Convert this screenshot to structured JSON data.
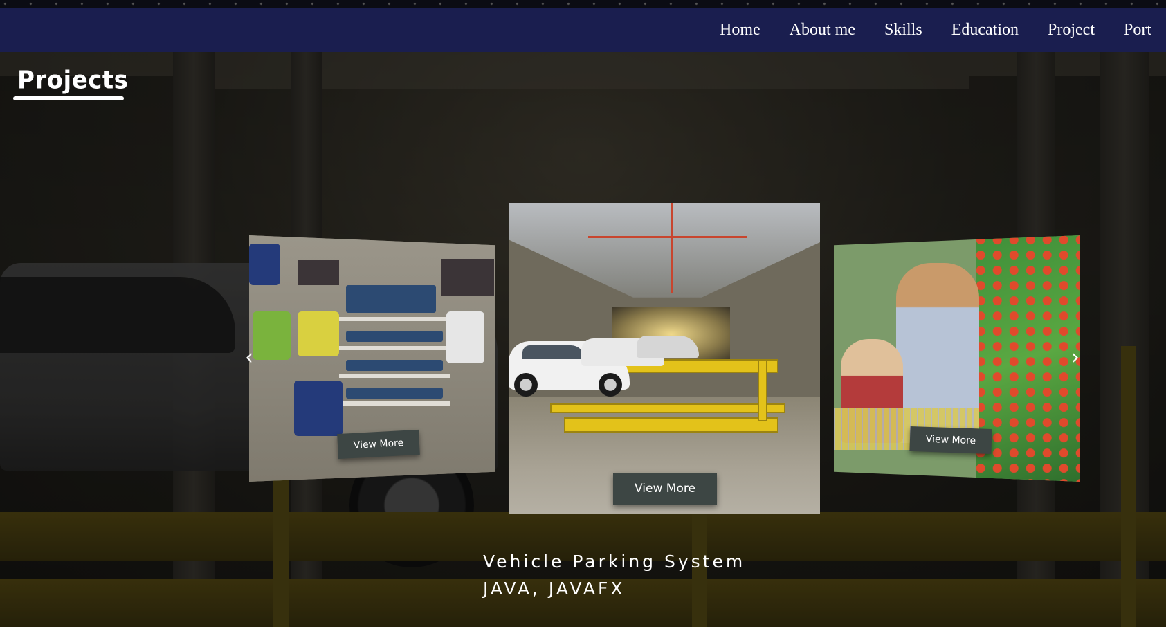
{
  "nav": {
    "items": [
      {
        "label": "Home"
      },
      {
        "label": "About me"
      },
      {
        "label": "Skills"
      },
      {
        "label": "Education"
      },
      {
        "label": "Project"
      },
      {
        "label": "Port"
      }
    ]
  },
  "section": {
    "title": "Projects"
  },
  "carousel": {
    "prev_icon": "chevron-left-icon",
    "next_icon": "chevron-right-icon",
    "prev_glyph": "‹",
    "next_glyph": "›",
    "slides": [
      {
        "image": "clothing-store",
        "button_label": "View More"
      },
      {
        "image": "vehicle-parking",
        "button_label": "View More"
      },
      {
        "image": "grocery-shopping",
        "button_label": "View More"
      }
    ],
    "active": {
      "name": "Vehicle Parking System",
      "tech": "JAVA, JAVAFX"
    }
  },
  "colors": {
    "navbar": "#1a1e4f",
    "button": "#3d4644",
    "text": "#ffffff"
  }
}
